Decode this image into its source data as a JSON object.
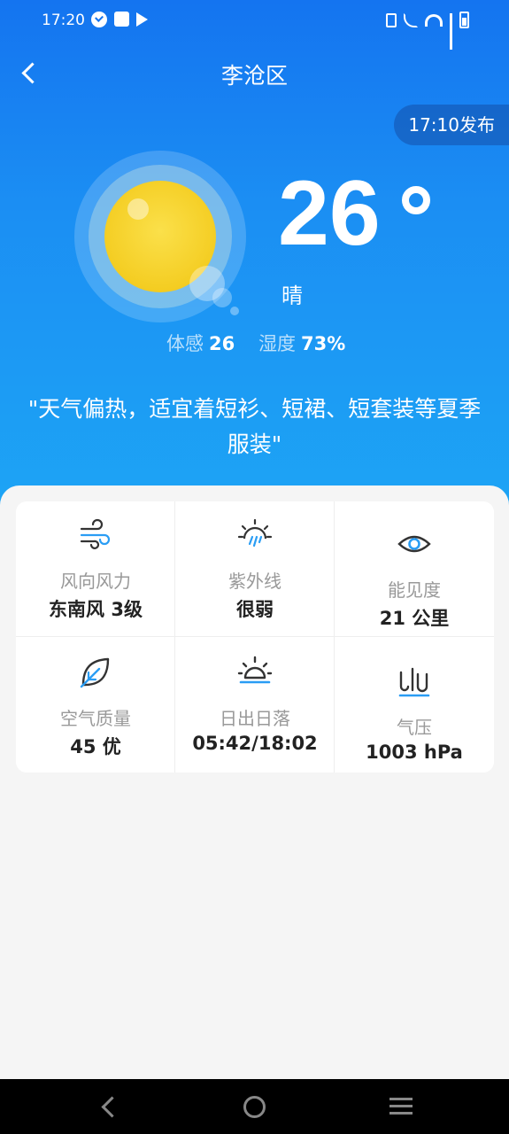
{
  "status_bar": {
    "time": "17:20",
    "left_icons": [
      "check-circle-icon",
      "mail-icon",
      "play-store-icon"
    ],
    "right_icons": [
      "vibrate-icon",
      "wifi-call-icon",
      "wifi-icon",
      "signal-icon",
      "battery-icon"
    ]
  },
  "header": {
    "title": "李沧区",
    "publish_time": "17:10发布"
  },
  "current": {
    "temperature": "26",
    "condition": "晴",
    "feels_label": "体感",
    "feels_value": "26",
    "humidity_label": "湿度",
    "humidity_value": "73%",
    "advice": "\"天气偏热，适宜着短衫、短裙、短套装等夏季服装\""
  },
  "details": [
    {
      "icon": "wind-icon",
      "label": "风向风力",
      "value": "东南风 3级"
    },
    {
      "icon": "uv-icon",
      "label": "紫外线",
      "value": "很弱"
    },
    {
      "icon": "eye-icon",
      "label": "能见度",
      "value": "21 公里"
    },
    {
      "icon": "leaf-icon",
      "label": "空气质量",
      "value": "45 优"
    },
    {
      "icon": "sunrise-icon",
      "label": "日出日落",
      "value": "05:42/18:02"
    },
    {
      "icon": "pressure-icon",
      "label": "气压",
      "value": "1003 hPa"
    }
  ],
  "colors": {
    "hero_top": "#1474f0",
    "hero_bottom": "#1da4f5",
    "sun": "#f4cd22",
    "icon_dark": "#333333",
    "icon_accent": "#2a9df4"
  }
}
